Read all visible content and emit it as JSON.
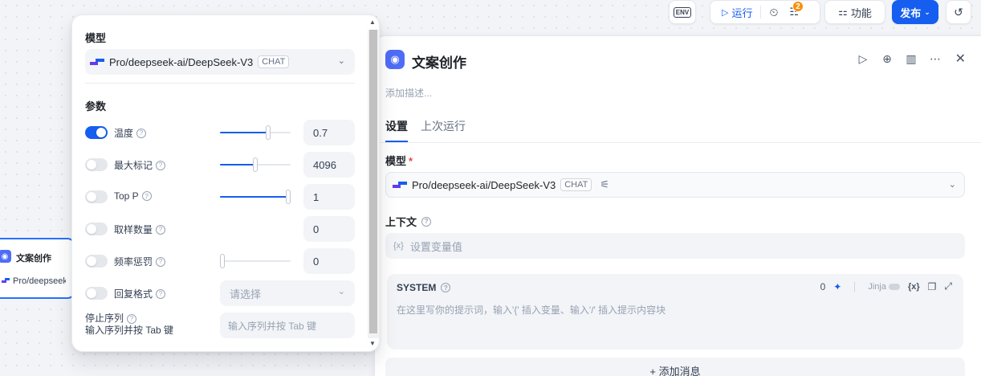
{
  "canvas_node": {
    "title": "文案创作",
    "model": "Pro/deepseek"
  },
  "toolbar": {
    "env_label": "ENV",
    "run_label": "运行",
    "badge_count": "2",
    "features_label": "功能",
    "publish_label": "发布"
  },
  "panel": {
    "title": "文案创作",
    "description_placeholder": "添加描述...",
    "tabs": [
      "设置",
      "上次运行"
    ],
    "model_label": "模型",
    "required_mark": "*",
    "model_name": "Pro/deepseek-ai/DeepSeek-V3",
    "model_tag": "CHAT",
    "context_label": "上下文",
    "context_prefix": "{x}",
    "context_placeholder": "设置变量值",
    "system_title": "SYSTEM",
    "system_count": "0",
    "jinja_label": "Jinja",
    "system_placeholder": "在这里写你的提示词，输入'{' 插入变量、输入'/' 插入提示内容块",
    "add_message_label": "+ 添加消息"
  },
  "popover": {
    "model_label": "模型",
    "model_name": "Pro/deepseek-ai/DeepSeek-V3",
    "model_tag": "CHAT",
    "params_label": "参数",
    "params": [
      {
        "name": "温度",
        "enabled": true,
        "value": "0.7",
        "slider": 0.7
      },
      {
        "name": "最大标记",
        "enabled": false,
        "value": "4096",
        "slider": 0.5
      },
      {
        "name": "Top P",
        "enabled": false,
        "value": "1",
        "slider": 1.0
      },
      {
        "name": "取样数量",
        "enabled": false,
        "value": "0"
      },
      {
        "name": "频率惩罚",
        "enabled": false,
        "value": "0",
        "slider": 0.0
      },
      {
        "name": "回复格式",
        "enabled": false,
        "select_placeholder": "请选择"
      }
    ],
    "stop_label": "停止序列",
    "stop_hint": "输入序列并按 Tab 键",
    "stop_placeholder": "输入序列并按 Tab 键"
  }
}
